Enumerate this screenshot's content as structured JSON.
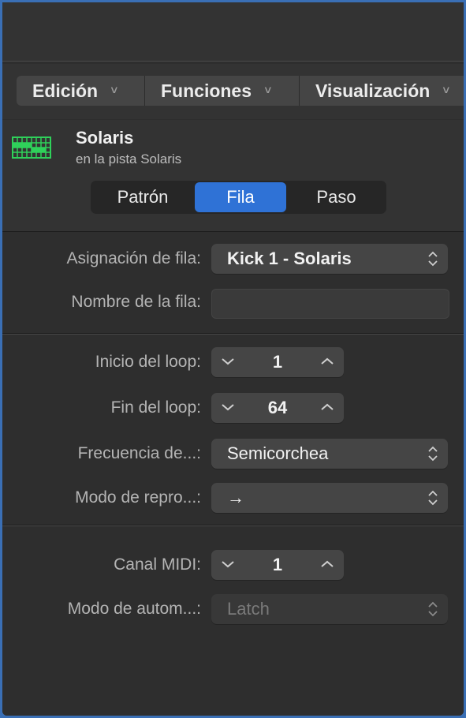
{
  "menubar": {
    "items": [
      {
        "label": "Edición",
        "icon": "chevron-down-icon"
      },
      {
        "label": "Funciones",
        "icon": "chevron-down-icon"
      },
      {
        "label": "Visualización",
        "icon": "chevron-down-icon"
      }
    ]
  },
  "region": {
    "name": "Solaris",
    "subtitle": "en la pista Solaris",
    "icon": "step-sequencer-grid-icon",
    "icon_color": "#2fd15a"
  },
  "mode_tabs": {
    "items": [
      "Patrón",
      "Fila",
      "Paso"
    ],
    "selected": "Fila",
    "accent": "#2f72d6"
  },
  "row_section": {
    "assignment_label": "Asignación de fila:",
    "assignment_value": "Kick 1 - Solaris",
    "name_label": "Nombre de la fila:",
    "name_value": ""
  },
  "loop_section": {
    "start_label": "Inicio del loop:",
    "start_value": "1",
    "end_label": "Fin del loop:",
    "end_value": "64",
    "rate_label": "Frecuencia de...:",
    "rate_value": "Semicorchea",
    "playmode_label": "Modo de repro...:",
    "playmode_value": "→"
  },
  "midi_section": {
    "channel_label": "Canal MIDI:",
    "channel_value": "1",
    "automation_label": "Modo de autom...:",
    "automation_value": "Latch"
  }
}
